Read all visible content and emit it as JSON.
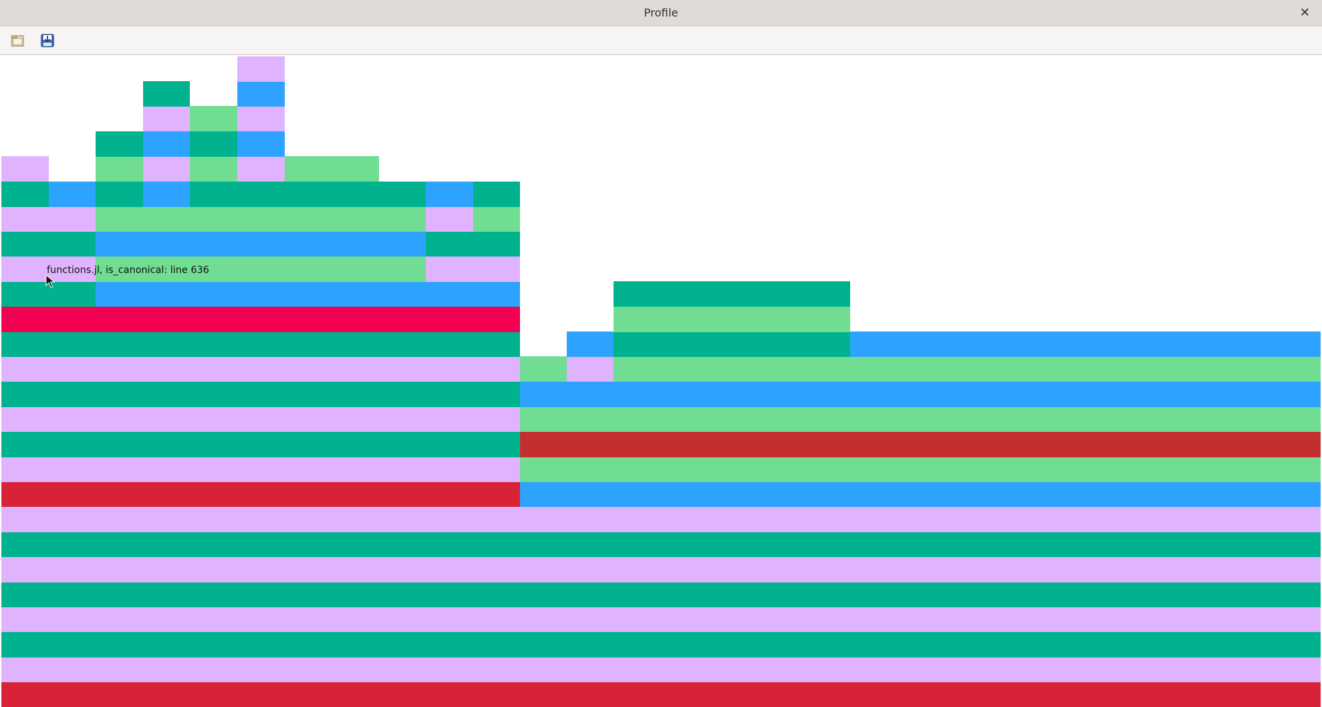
{
  "window": {
    "title": "Profile",
    "close_glyph": "✕"
  },
  "toolbar": {
    "buttons": [
      {
        "name": "open-file-button",
        "icon": "folder-open-icon"
      },
      {
        "name": "save-file-button",
        "icon": "save-download-icon"
      }
    ]
  },
  "colors": {
    "teal": "#00b38e",
    "lavender": "#e0b3ff",
    "blue": "#2da3ff",
    "light_green": "#70dd93",
    "red_dark": "#c52e2e",
    "red": "#d72237",
    "hot_pink": "#f20052"
  },
  "flame": {
    "rows": [
      {
        "row": 0,
        "segments": [
          [
            "#d72237",
            0,
            1918
          ]
        ]
      },
      {
        "row": 1,
        "segments": [
          [
            "#e0b3ff",
            0,
            1918
          ]
        ]
      },
      {
        "row": 2,
        "segments": [
          [
            "#00b38e",
            0,
            1918
          ]
        ]
      },
      {
        "row": 3,
        "segments": [
          [
            "#e0b3ff",
            0,
            1918
          ]
        ]
      },
      {
        "row": 4,
        "segments": [
          [
            "#00b38e",
            0,
            1918
          ]
        ]
      },
      {
        "row": 5,
        "segments": [
          [
            "#e0b3ff",
            0,
            1918
          ]
        ]
      },
      {
        "row": 6,
        "segments": [
          [
            "#00b38e",
            0,
            1918
          ]
        ]
      },
      {
        "row": 7,
        "segments": [
          [
            "#e0b3ff",
            0,
            1918
          ]
        ]
      },
      {
        "row": 8,
        "segments": [
          [
            "#d72237",
            0,
            754
          ],
          [
            "#2da3ff",
            754,
            1918
          ]
        ]
      },
      {
        "row": 9,
        "segments": [
          [
            "#e0b3ff",
            0,
            754
          ],
          [
            "#70dd93",
            754,
            1918
          ]
        ]
      },
      {
        "row": 10,
        "segments": [
          [
            "#00b38e",
            0,
            754
          ],
          [
            "#c52e2e",
            754,
            1918
          ]
        ]
      },
      {
        "row": 11,
        "segments": [
          [
            "#e0b3ff",
            0,
            754
          ],
          [
            "#70dd93",
            754,
            1918
          ]
        ]
      },
      {
        "row": 12,
        "segments": [
          [
            "#00b38e",
            0,
            754
          ],
          [
            "#2da3ff",
            754,
            1918
          ]
        ]
      },
      {
        "row": 13,
        "segments": [
          [
            "#e0b3ff",
            0,
            754
          ],
          [
            "#70dd93",
            754,
            822
          ],
          [
            "#e0b3ff",
            822,
            890
          ],
          [
            "#70dd93",
            890,
            1918
          ]
        ]
      },
      {
        "row": 14,
        "segments": [
          [
            "#00b38e",
            0,
            754
          ],
          [
            "#2da3ff",
            822,
            890
          ],
          [
            "#00b38e",
            890,
            1234
          ],
          [
            "#2da3ff",
            1234,
            1918
          ]
        ]
      },
      {
        "row": 15,
        "segments": [
          [
            "#f20052",
            0,
            754
          ],
          [
            "#70dd93",
            890,
            1234
          ]
        ]
      },
      {
        "row": 16,
        "segments": [
          [
            "#00b38e",
            0,
            137
          ],
          [
            "#2da3ff",
            137,
            754
          ],
          [
            "#00b38e",
            890,
            1234
          ]
        ]
      },
      {
        "row": 17,
        "segments": [
          [
            "#e0b3ff",
            0,
            137
          ],
          [
            "#70dd93",
            137,
            617
          ],
          [
            "#e0b3ff",
            617,
            754
          ]
        ]
      },
      {
        "row": 18,
        "segments": [
          [
            "#00b38e",
            0,
            137
          ],
          [
            "#2da3ff",
            137,
            617
          ],
          [
            "#00b38e",
            617,
            754
          ]
        ]
      },
      {
        "row": 19,
        "segments": [
          [
            "#e0b3ff",
            0,
            137
          ],
          [
            "#70dd93",
            137,
            617
          ],
          [
            "#e0b3ff",
            617,
            686
          ],
          [
            "#70dd93",
            686,
            754
          ]
        ]
      },
      {
        "row": 20,
        "segments": [
          [
            "#00b38e",
            0,
            69
          ],
          [
            "#2da3ff",
            69,
            137
          ],
          [
            "#00b38e",
            137,
            206
          ],
          [
            "#2da3ff",
            206,
            274
          ],
          [
            "#00b38e",
            274,
            617
          ],
          [
            "#2da3ff",
            617,
            686
          ],
          [
            "#00b38e",
            686,
            754
          ]
        ]
      },
      {
        "row": 21,
        "segments": [
          [
            "#e0b3ff",
            0,
            69
          ],
          [
            "#70dd93",
            137,
            206
          ],
          [
            "#e0b3ff",
            206,
            274
          ],
          [
            "#70dd93",
            274,
            343
          ],
          [
            "#e0b3ff",
            343,
            412
          ],
          [
            "#70dd93",
            412,
            549
          ]
        ]
      },
      {
        "row": 22,
        "segments": [
          [
            "#00b38e",
            137,
            206
          ],
          [
            "#2da3ff",
            206,
            274
          ],
          [
            "#00b38e",
            274,
            343
          ],
          [
            "#2da3ff",
            343,
            412
          ]
        ]
      },
      {
        "row": 23,
        "segments": [
          [
            "#e0b3ff",
            206,
            274
          ],
          [
            "#70dd93",
            274,
            343
          ],
          [
            "#e0b3ff",
            343,
            412
          ]
        ]
      },
      {
        "row": 24,
        "segments": [
          [
            "#00b38e",
            206,
            274
          ],
          [
            "#2da3ff",
            343,
            412
          ]
        ]
      },
      {
        "row": 25,
        "segments": [
          [
            "#e0b3ff",
            343,
            412
          ]
        ]
      }
    ]
  },
  "tooltip": {
    "text": "functions.jl, is_canonical: line 636"
  }
}
